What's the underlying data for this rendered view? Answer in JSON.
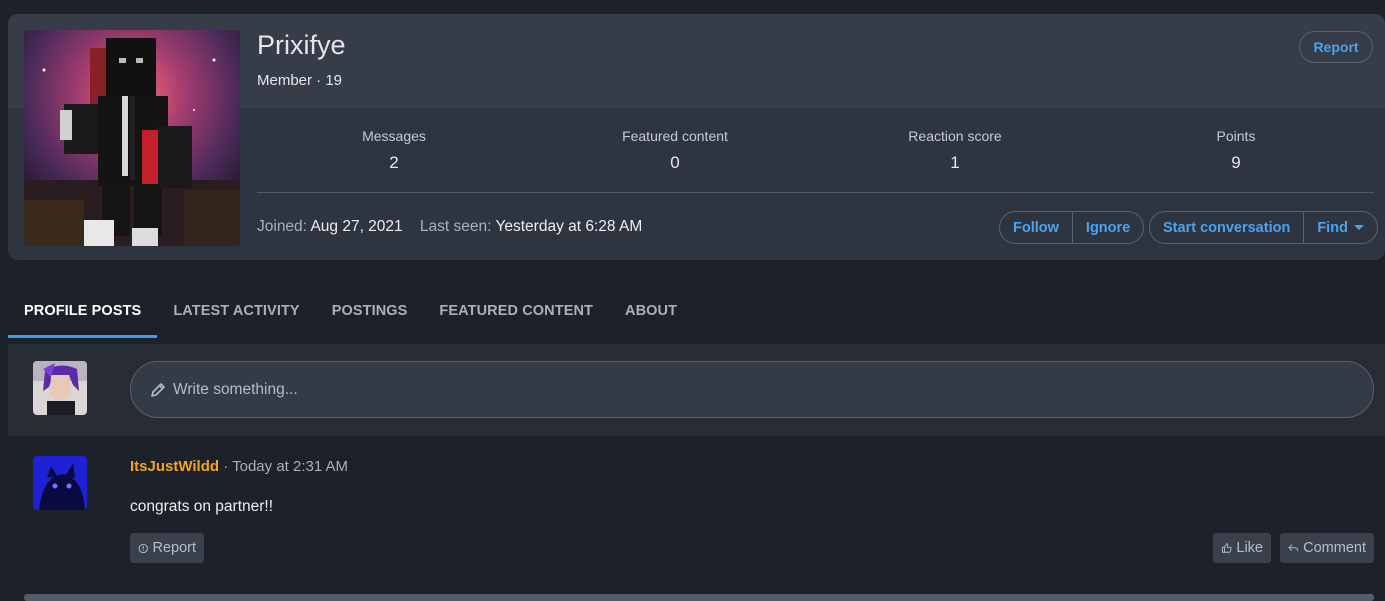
{
  "profile": {
    "username": "Prixifye",
    "member_line": "Member · 19",
    "report_label": "Report",
    "stats": [
      {
        "label": "Messages",
        "value": "2"
      },
      {
        "label": "Featured content",
        "value": "0"
      },
      {
        "label": "Reaction score",
        "value": "1"
      },
      {
        "label": "Points",
        "value": "9"
      }
    ],
    "joined_label": "Joined:",
    "joined_value": "Aug 27, 2021",
    "last_seen_label": "Last seen:",
    "last_seen_value": "Yesterday at 6:28 AM",
    "actions": {
      "follow": "Follow",
      "ignore": "Ignore",
      "start_conversation": "Start conversation",
      "find": "Find"
    }
  },
  "tabs": [
    {
      "label": "PROFILE POSTS",
      "active": true
    },
    {
      "label": "LATEST ACTIVITY",
      "active": false
    },
    {
      "label": "POSTINGS",
      "active": false
    },
    {
      "label": "FEATURED CONTENT",
      "active": false
    },
    {
      "label": "ABOUT",
      "active": false
    }
  ],
  "composer": {
    "placeholder": "Write something...",
    "icon": "pencil-icon"
  },
  "post": {
    "author": "ItsJustWildd",
    "separator": "·",
    "time": "Today at 2:31 AM",
    "body": "congrats on partner!!",
    "report_label": "Report",
    "like_label": "Like",
    "comment_label": "Comment"
  },
  "colors": {
    "accent": "#4aa3f0",
    "author_name": "#f0a525",
    "active_tab_underline": "#3d9fe6"
  }
}
